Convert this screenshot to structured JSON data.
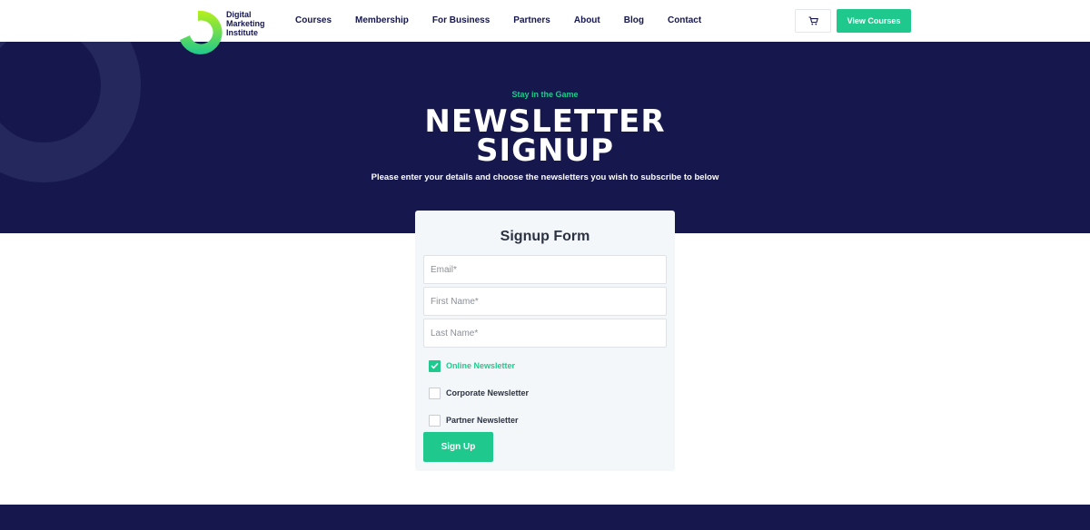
{
  "brand": {
    "logo_lines": [
      "Digital",
      "Marketing",
      "Institute"
    ],
    "colors": {
      "primary_navy": "#15174d",
      "accent_green": "#1fc98e"
    }
  },
  "nav": {
    "items": [
      "Courses",
      "Membership",
      "For Business",
      "Partners",
      "About",
      "Blog",
      "Contact"
    ]
  },
  "header": {
    "cart_icon": "cart-icon",
    "cta_label": "View Courses"
  },
  "hero": {
    "tagline": "Stay in the Game",
    "title_line1": "NEWSLETTER",
    "title_line2": "SIGNUP",
    "subtitle": "Please enter your details and choose the newsletters you wish to subscribe to below"
  },
  "form": {
    "title": "Signup Form",
    "fields": [
      {
        "placeholder": "Email*",
        "value": ""
      },
      {
        "placeholder": "First Name*",
        "value": ""
      },
      {
        "placeholder": "Last Name*",
        "value": ""
      }
    ],
    "newsletters": [
      {
        "label": "Online Newsletter",
        "checked": true
      },
      {
        "label": "Corporate Newsletter",
        "checked": false
      },
      {
        "label": "Partner Newsletter",
        "checked": false
      }
    ],
    "submit_label": "Sign Up"
  }
}
